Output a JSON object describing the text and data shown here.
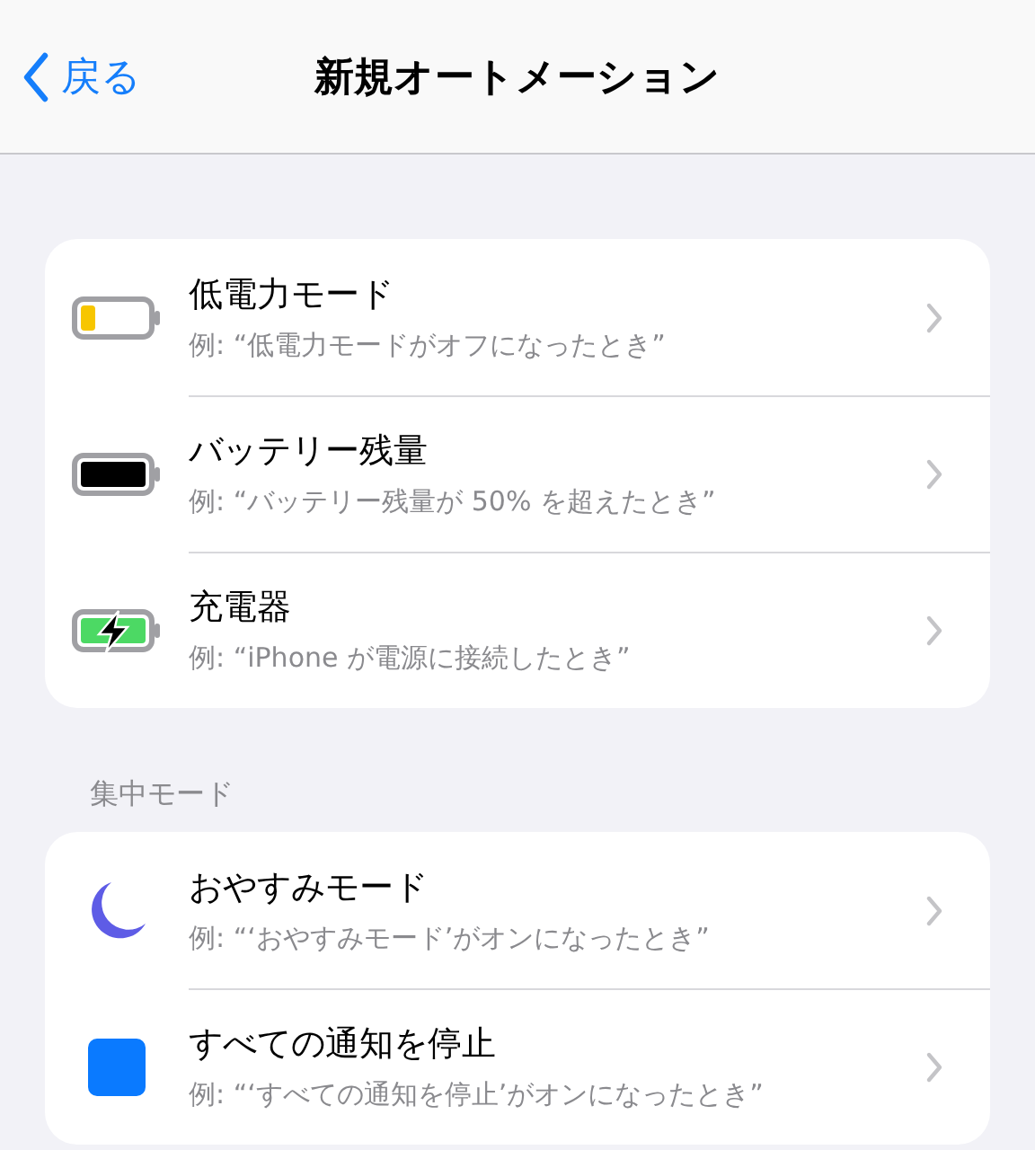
{
  "nav": {
    "back": "戻る",
    "title": "新規オートメーション"
  },
  "sections": [
    {
      "rows": [
        {
          "kind": "battery-low",
          "title": "低電力モード",
          "example": "例: “低電力モードがオフになったとき”"
        },
        {
          "kind": "battery-full",
          "title": "バッテリー残量",
          "example": "例: “バッテリー残量が 50% を超えたとき”"
        },
        {
          "kind": "battery-charging",
          "title": "充電器",
          "example": "例: “iPhone が電源に接続したとき”"
        }
      ]
    },
    {
      "header": "集中モード",
      "rows": [
        {
          "kind": "moon",
          "title": "おやすみモード",
          "example": "例: “‘おやすみモード’がオンになったとき”"
        },
        {
          "kind": "square",
          "title": "すべての通知を停止",
          "example": "例: “‘すべての通知を停止’がオンになったとき”"
        }
      ]
    }
  ]
}
